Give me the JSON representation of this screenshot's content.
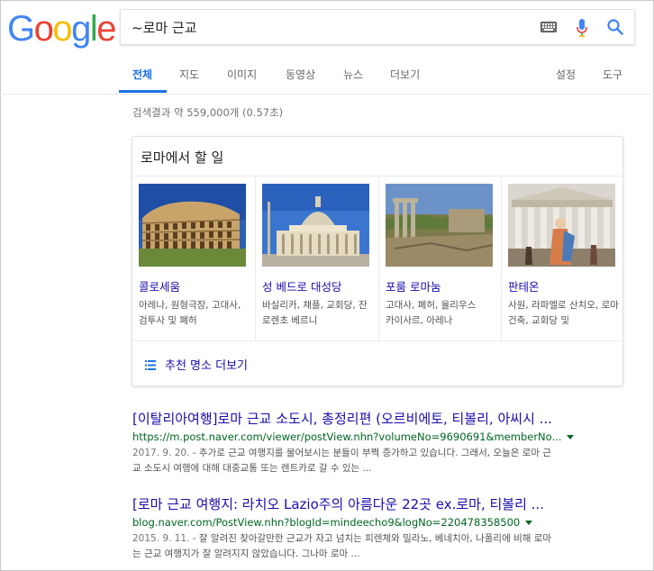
{
  "logo": {
    "letters": [
      "G",
      "o",
      "o",
      "g",
      "l",
      "e"
    ],
    "colors": [
      "#4285f4",
      "#ea4335",
      "#fbbc05",
      "#4285f4",
      "#34a853",
      "#ea4335"
    ]
  },
  "search": {
    "query": "~로마 근교",
    "keyboard_icon": "keyboard-icon",
    "mic_icon": "microphone-icon",
    "search_icon": "search-icon"
  },
  "tabs": {
    "all": "전체",
    "maps": "지도",
    "images": "이미지",
    "videos": "동영상",
    "news": "뉴스",
    "more": "더보기",
    "settings": "설정",
    "tools": "도구"
  },
  "stats": "검색결과 약 559,000개 (0.57초)",
  "card": {
    "title": "로마에서 할 일",
    "places": [
      {
        "name": "콜로세움",
        "desc": "아레나, 원형극장, 고대사, 검투사 및 폐허"
      },
      {
        "name": "성 베드로 대성당",
        "desc": "바실리카, 채플, 교회당, 잔 로렌초 베르니"
      },
      {
        "name": "포룸 로마눔",
        "desc": "고대사, 폐허, 율리우스 카이사르, 아레나"
      },
      {
        "name": "판테온",
        "desc": "사원, 라파엘로 산치오, 로마 건축, 교회당 및"
      }
    ],
    "more_label": "추천 명소 더보기"
  },
  "results": [
    {
      "title": "[이탈리아여행]로마 근교 소도시, 총정리편 (오르비에토, 티볼리, 아씨시 ...",
      "url": "https://m.post.naver.com/viewer/postView.nhn?volumeNo=9690691&memberNo...",
      "date": "2017. 9. 20.",
      "snippet_1": " - 추가로 근교 여행지를 물어보시는 분들이 부쩍 증가하고 있습니다. 그래서, 오늘은 로마 근",
      "snippet_2": "교 소도시 여행에 대해 대중교통 또는 렌트카로 갈 수 있는 ..."
    },
    {
      "title": "[로마 근교 여행지: 라치오 Lazio주의 아름다운 22곳 ex.로마, 티볼리 ...",
      "url": "blog.naver.com/PostView.nhn?blogId=mindeecho9&logNo=220478358500",
      "date": "2015. 9. 11.",
      "snippet_1": " - 잘 알려진 찾아갈만한 근교가 자고 넘치는 피렌체와 밀라노, 베네치아, 나폴리에 비해 로마",
      "snippet_2": "는 근교 여행지가 잘 알려지지 않았습니다. 그나마 로마 ..."
    }
  ]
}
